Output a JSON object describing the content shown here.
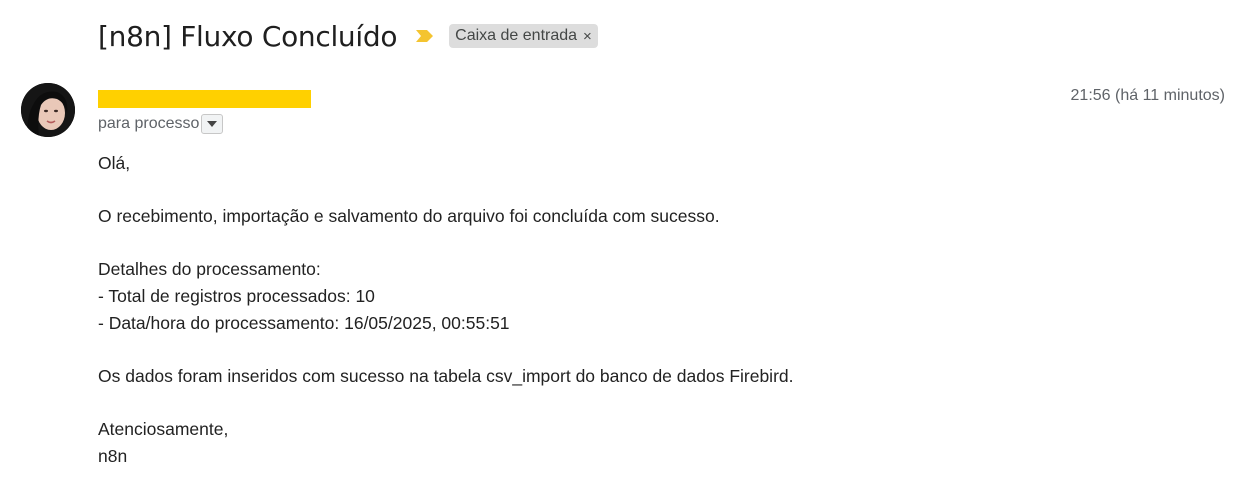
{
  "email": {
    "subject": "[n8n] Fluxo Concluído",
    "label_chip": {
      "text": "Caixa de entrada",
      "close_symbol": "×"
    },
    "importance_marker": {
      "icon": "importance-marker-icon",
      "color": "#f4c430"
    },
    "sender": {
      "name_redacted": true,
      "redaction_color": "#ffd000",
      "avatar": "avatar-photo"
    },
    "recipient_text": "para processo",
    "timestamp": "21:56 (há 11 minutos)",
    "body_lines": [
      "Olá,",
      "",
      "O recebimento, importação e salvamento do arquivo foi concluída com sucesso.",
      "",
      "Detalhes do processamento:",
      "- Total de registros processados: 10",
      "- Data/hora do processamento: 16/05/2025, 00:55:51",
      "",
      "Os dados foram inseridos com sucesso na tabela csv_import do banco de dados Firebird.",
      "",
      "Atenciosamente,",
      "n8n"
    ]
  }
}
